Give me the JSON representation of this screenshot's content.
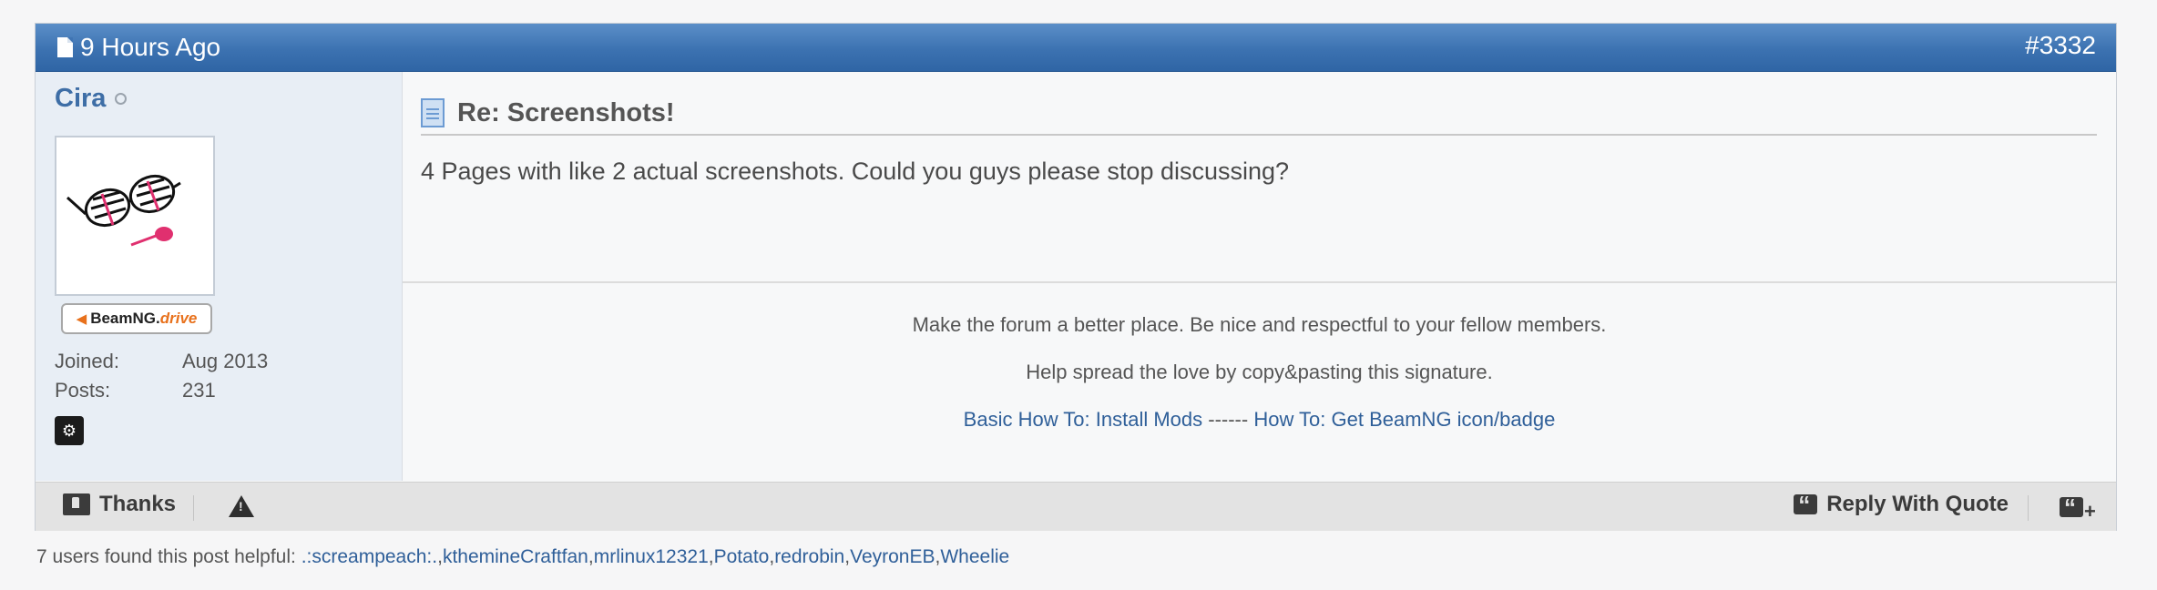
{
  "post": {
    "date": "9 Hours Ago",
    "number": "#3332",
    "title": "Re: Screenshots!",
    "message": "4 Pages with like 2 actual screenshots. Could you guys please stop discussing?"
  },
  "user": {
    "name": "Cira",
    "status": "offline",
    "badge_brand": "BeamNG.",
    "badge_drive": "drive",
    "stats": [
      {
        "label": "Joined:",
        "value": "Aug 2013"
      },
      {
        "label": "Posts:",
        "value": "231"
      }
    ]
  },
  "signature": {
    "line1": "Make the forum a better place. Be nice and respectful to your fellow members.",
    "line2": "Help spread the love by copy&pasting this signature.",
    "link1": "Basic How To: Install Mods",
    "divider": " ------ ",
    "link2": "How To: Get BeamNG icon/badge"
  },
  "footer": {
    "thanks_label": "Thanks",
    "reply_quote_label": "Reply With Quote"
  },
  "helpful": {
    "prefix": "7 users found this post helpful: ",
    "users": [
      ".:screampeach:.",
      "kthemineCraftfan",
      "mrlinux12321",
      "Potato",
      "redrobin",
      "VeyronEB",
      "Wheelie"
    ]
  },
  "colors": {
    "header_blue": "#3c72b1",
    "link_blue": "#2f5f99",
    "username_blue": "#3e6ea6",
    "badge_orange": "#e8711c"
  }
}
